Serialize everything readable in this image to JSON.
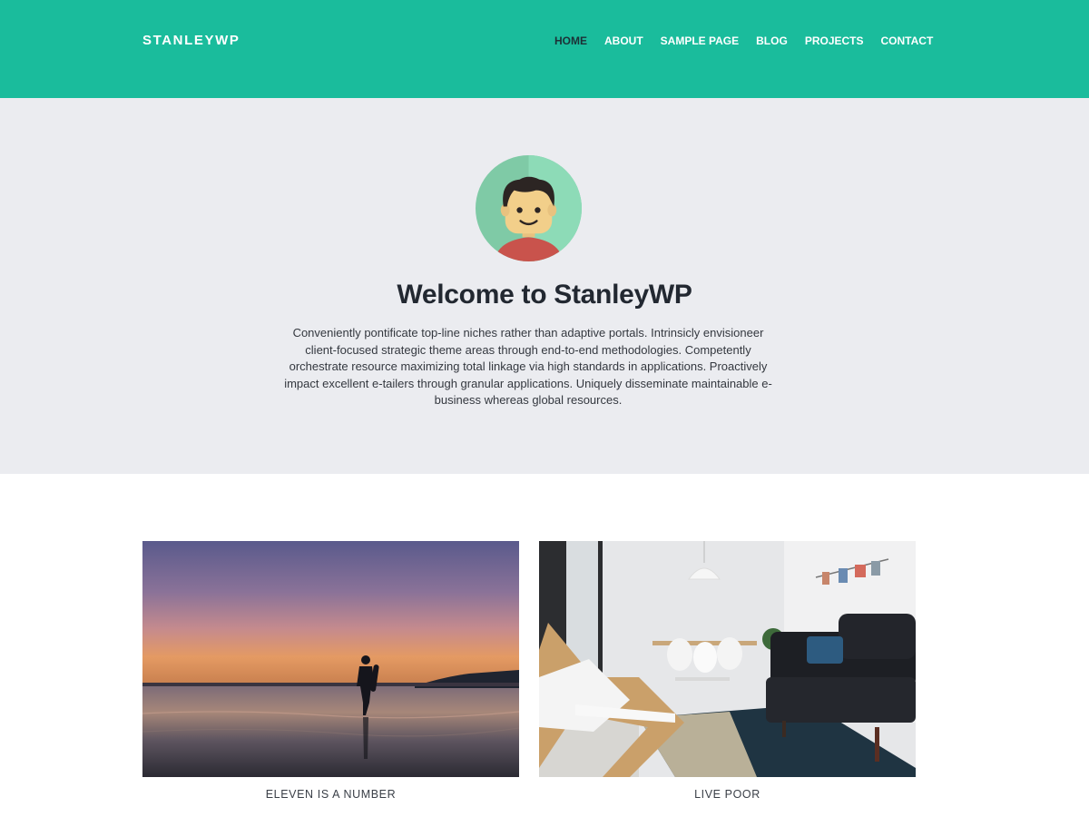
{
  "header": {
    "site_title": "STANLEYWP",
    "brand_color": "#1abc9c",
    "nav": [
      {
        "label": "HOME",
        "active": true
      },
      {
        "label": "ABOUT",
        "active": false
      },
      {
        "label": "SAMPLE PAGE",
        "active": false
      },
      {
        "label": "BLOG",
        "active": false
      },
      {
        "label": "PROJECTS",
        "active": false
      },
      {
        "label": "CONTACT",
        "active": false
      }
    ]
  },
  "hero": {
    "avatar_icon": "avatar-illustration",
    "title": "Welcome to StanleyWP",
    "text": "Conveniently pontificate top-line niches rather than adaptive portals. Intrinsicly envisioneer client-focused strategic theme areas through end-to-end methodologies. Competently orchestrate resource maximizing total linkage via high standards in applications. Proactively impact excellent e-tailers through granular applications. Uniquely disseminate maintainable e-business whereas global resources."
  },
  "posts": [
    {
      "title": "ELEVEN IS A NUMBER",
      "image": "sunset-beach-silhouette"
    },
    {
      "title": "LIVE POOR",
      "image": "living-room-interior"
    }
  ]
}
